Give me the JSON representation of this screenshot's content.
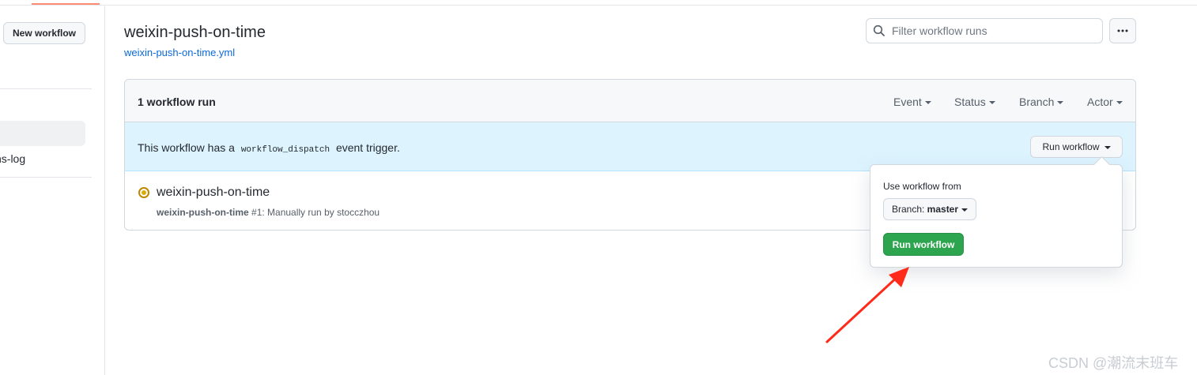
{
  "sidebar": {
    "new_workflow_label": "New workflow",
    "item_partial": "ns-log"
  },
  "header": {
    "title": "weixin-push-on-time",
    "file_link": "weixin-push-on-time.yml",
    "filter_placeholder": "Filter workflow runs",
    "more_icon": "kebab-horizontal-icon"
  },
  "runs": {
    "count_label": "1 workflow run",
    "filters": [
      "Event",
      "Status",
      "Branch",
      "Actor"
    ],
    "dispatch_prefix": "This workflow has a",
    "dispatch_code": "workflow_dispatch",
    "dispatch_suffix": "event trigger.",
    "run_workflow_label": "Run workflow",
    "items": [
      {
        "title": "weixin-push-on-time",
        "workflow_name": "weixin-push-on-time",
        "meta_rest": "#1: Manually run by stocczhou",
        "status": "queued"
      }
    ]
  },
  "popover": {
    "label": "Use workflow from",
    "branch_button": "Branch: master",
    "branch_prefix": "Branch:",
    "branch_value": "master",
    "run_button": "Run workflow"
  },
  "colors": {
    "accent_link": "#0969da",
    "primary_button": "#2da44e",
    "banner_bg": "#ddf4ff",
    "annotation_arrow": "#ff2a1a"
  },
  "watermark": "CSDN @潮流末班车"
}
